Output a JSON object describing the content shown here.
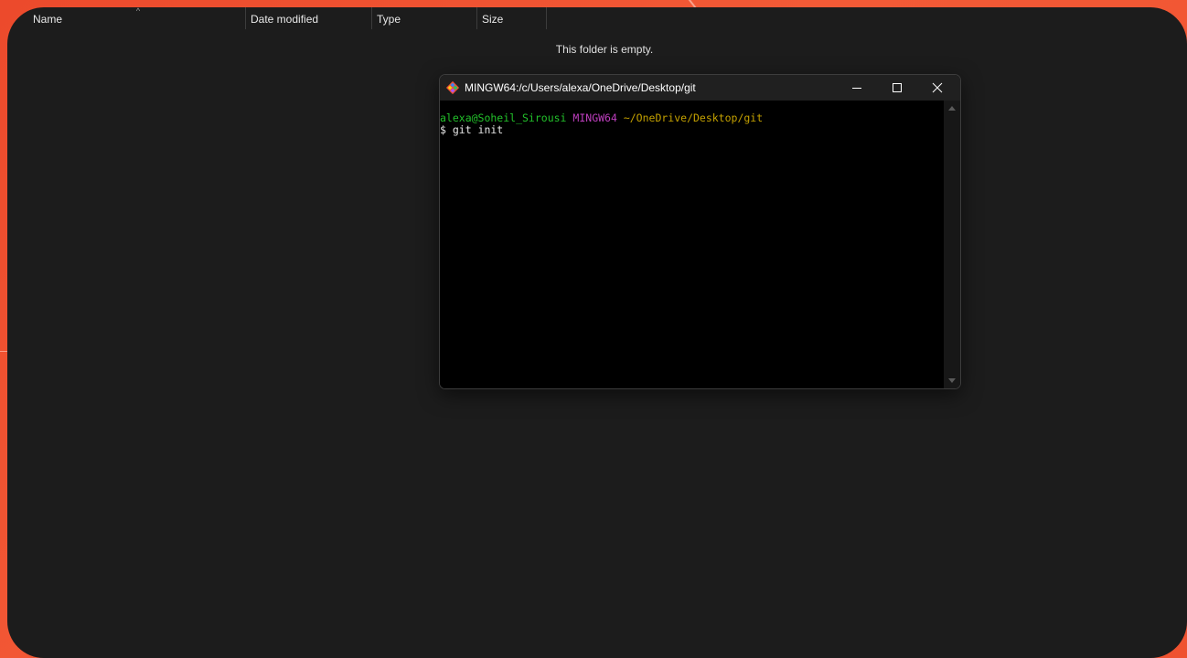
{
  "explorer": {
    "columns": {
      "name": "Name",
      "date_modified": "Date modified",
      "type": "Type",
      "size": "Size"
    },
    "empty_message": "This folder is empty."
  },
  "terminal": {
    "title": "MINGW64:/c/Users/alexa/OneDrive/Desktop/git",
    "icon": "git-icon",
    "prompt": {
      "user_host": "alexa@Soheil_Sirousi",
      "system": "MINGW64",
      "path": "~/OneDrive/Desktop/git"
    },
    "command_line": "$ git init"
  },
  "colors": {
    "background_accent": "#f0522f",
    "explorer_bg": "#1c1c1c",
    "prompt_user": "#22c12a",
    "prompt_system": "#bf3fbf",
    "prompt_path": "#c4a100"
  }
}
